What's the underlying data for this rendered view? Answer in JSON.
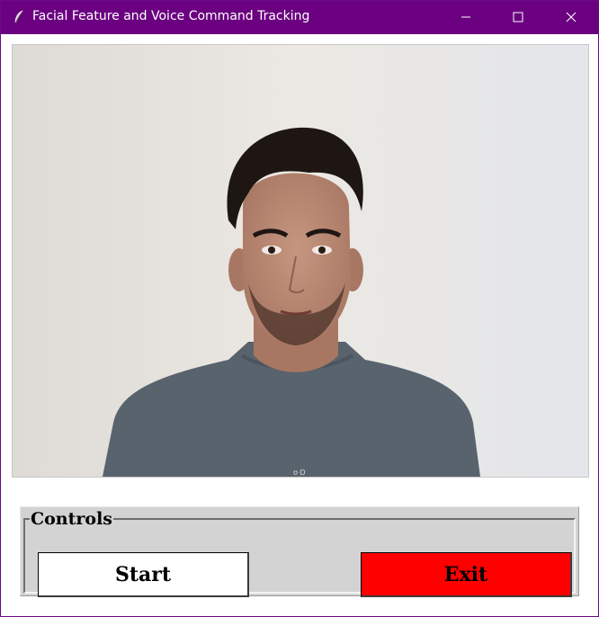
{
  "window": {
    "title": "Facial Feature and Voice Command Tracking",
    "titlebar_color": "#6b0080"
  },
  "icons": {
    "app": "feather-icon",
    "minimize": "minimize-icon",
    "maximize": "maximize-icon",
    "close": "close-icon"
  },
  "video": {
    "content": "camera-feed"
  },
  "controls": {
    "label": "Controls",
    "start_label": "Start",
    "exit_label": "Exit",
    "start_color": "#ffffff",
    "exit_color": "#ff0000"
  }
}
